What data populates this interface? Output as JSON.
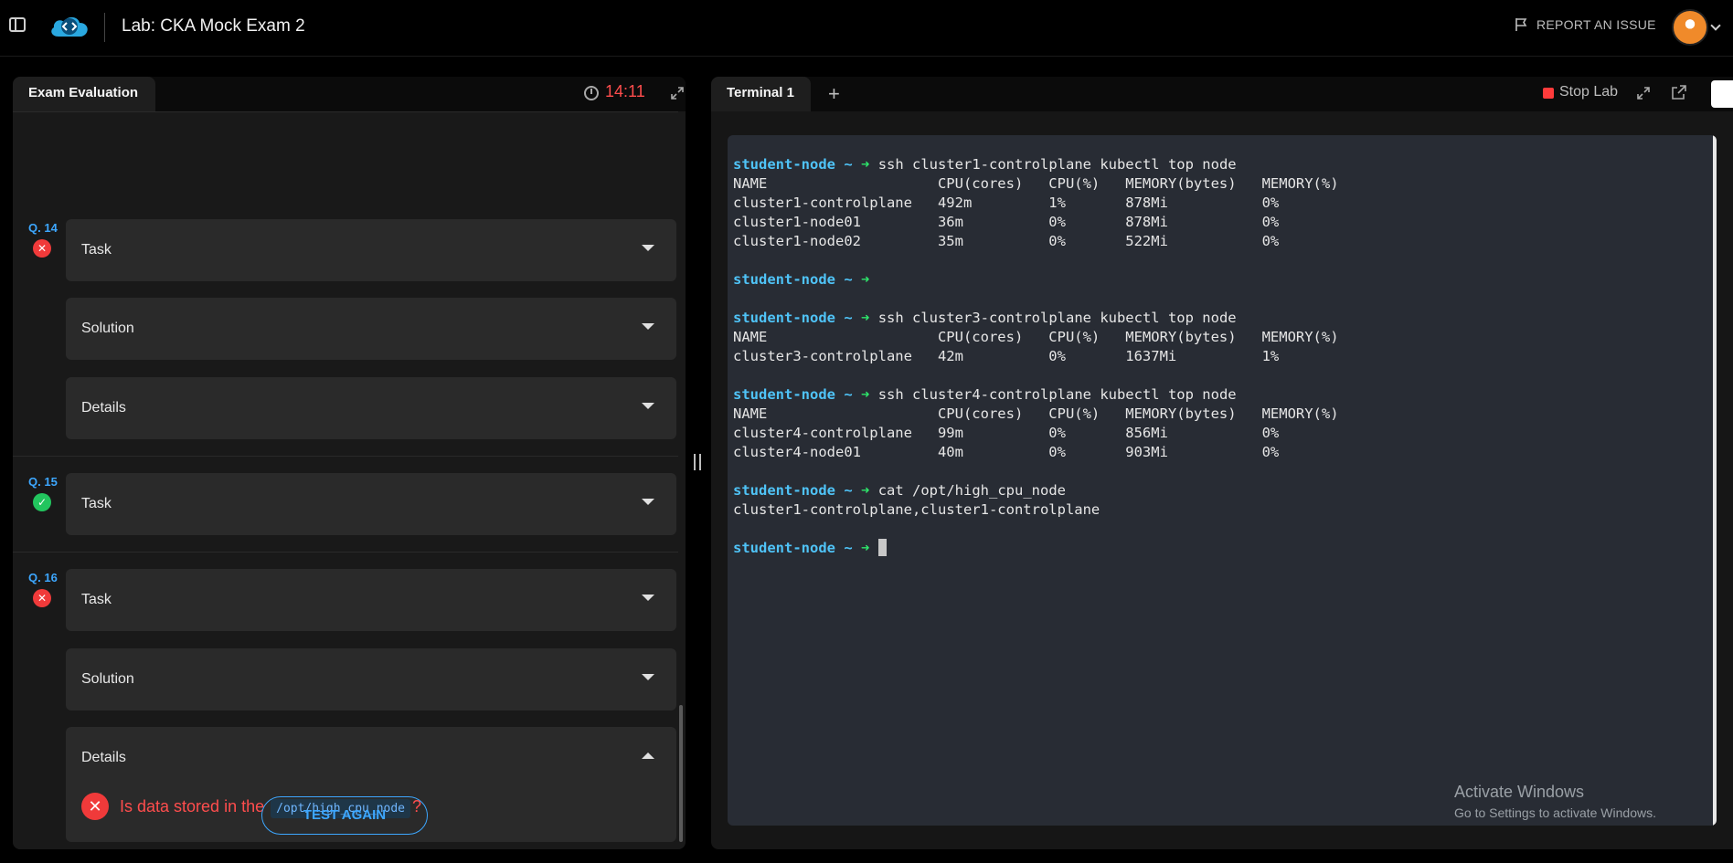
{
  "header": {
    "lab_title": "Lab: CKA Mock Exam 2",
    "report_label": "REPORT AN ISSUE"
  },
  "left_panel": {
    "tab_label": "Exam Evaluation",
    "timer": "14:11",
    "questions": [
      {
        "label": "Q. 14",
        "status": "fail",
        "sections": [
          {
            "title": "Task"
          },
          {
            "title": "Solution"
          },
          {
            "title": "Details"
          }
        ]
      },
      {
        "label": "Q. 15",
        "status": "pass",
        "sections": [
          {
            "title": "Task"
          }
        ]
      },
      {
        "label": "Q. 16",
        "status": "fail",
        "sections": [
          {
            "title": "Task"
          },
          {
            "title": "Solution"
          },
          {
            "title": "Details"
          }
        ],
        "detail_check": {
          "prefix": "Is data stored in the",
          "code": "/opt/high_cpu_node",
          "suffix": "?"
        }
      }
    ],
    "test_again_label": "TEST AGAIN"
  },
  "right_panel": {
    "tab_label": "Terminal 1",
    "add_tab": "+",
    "stop_label": "Stop Lab",
    "stop_color": "#ff3b3b",
    "prompt": "student-node ~",
    "prompt_arrow": "➜",
    "lines": [
      {
        "type": "prompt",
        "cmd": "ssh cluster1-controlplane kubectl top node"
      },
      {
        "type": "out",
        "text": "NAME                    CPU(cores)   CPU(%)   MEMORY(bytes)   MEMORY(%)"
      },
      {
        "type": "out",
        "text": "cluster1-controlplane   492m         1%       878Mi           0%"
      },
      {
        "type": "out",
        "text": "cluster1-node01         36m          0%       878Mi           0%"
      },
      {
        "type": "out",
        "text": "cluster1-node02         35m          0%       522Mi           0%"
      },
      {
        "type": "blank",
        "text": ""
      },
      {
        "type": "prompt",
        "cmd": ""
      },
      {
        "type": "blank",
        "text": ""
      },
      {
        "type": "prompt",
        "cmd": "ssh cluster3-controlplane kubectl top node"
      },
      {
        "type": "out",
        "text": "NAME                    CPU(cores)   CPU(%)   MEMORY(bytes)   MEMORY(%)"
      },
      {
        "type": "out",
        "text": "cluster3-controlplane   42m          0%       1637Mi          1%"
      },
      {
        "type": "blank",
        "text": ""
      },
      {
        "type": "prompt",
        "cmd": "ssh cluster4-controlplane kubectl top node"
      },
      {
        "type": "out",
        "text": "NAME                    CPU(cores)   CPU(%)   MEMORY(bytes)   MEMORY(%)"
      },
      {
        "type": "out",
        "text": "cluster4-controlplane   99m          0%       856Mi           0%"
      },
      {
        "type": "out",
        "text": "cluster4-node01         40m          0%       903Mi           0%"
      },
      {
        "type": "blank",
        "text": ""
      },
      {
        "type": "prompt",
        "cmd": "cat /opt/high_cpu_node"
      },
      {
        "type": "out",
        "text": "cluster1-controlplane,cluster1-controlplane"
      },
      {
        "type": "blank",
        "text": ""
      },
      {
        "type": "prompt",
        "cmd": "",
        "cursor": true
      }
    ]
  },
  "watermark": {
    "line1": "Activate Windows",
    "line2": "Go to Settings to activate Windows."
  },
  "colors": {
    "accent": "#3da7ff",
    "fail": "#f03a3a",
    "pass": "#22c55e",
    "timer": "#ff4d4d",
    "prompt_user": "#4fc3f7",
    "prompt_arrow": "#2ee66b",
    "terminal_bg": "#282c34"
  }
}
